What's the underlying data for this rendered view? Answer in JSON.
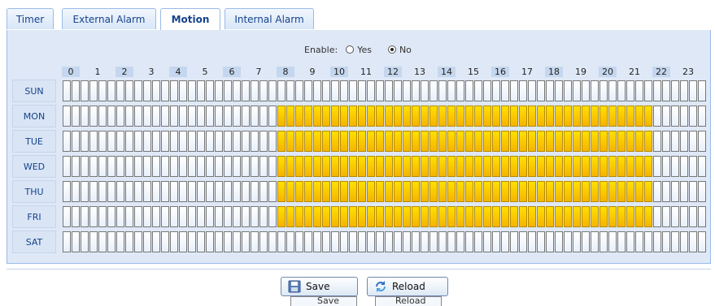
{
  "tabs": [
    {
      "label": "Timer",
      "active": false
    },
    {
      "label": "External Alarm",
      "active": false
    },
    {
      "label": "Motion",
      "active": true
    },
    {
      "label": "Internal Alarm",
      "active": false
    }
  ],
  "enable": {
    "label": "Enable:",
    "yes_label": "Yes",
    "no_label": "No",
    "selected": "No"
  },
  "hours": [
    "0",
    "1",
    "2",
    "3",
    "4",
    "5",
    "6",
    "7",
    "8",
    "9",
    "10",
    "11",
    "12",
    "13",
    "14",
    "15",
    "16",
    "17",
    "18",
    "19",
    "20",
    "21",
    "22",
    "23"
  ],
  "days": [
    "SUN",
    "MON",
    "TUE",
    "WED",
    "THU",
    "FRI",
    "SAT"
  ],
  "schedule": {
    "SUN": [],
    "MON": [
      8,
      9,
      10,
      11,
      12,
      13,
      14,
      15,
      16,
      17,
      18,
      19,
      20,
      21
    ],
    "TUE": [
      8,
      9,
      10,
      11,
      12,
      13,
      14,
      15,
      16,
      17,
      18,
      19,
      20,
      21
    ],
    "WED": [
      8,
      9,
      10,
      11,
      12,
      13,
      14,
      15,
      16,
      17,
      18,
      19,
      20,
      21
    ],
    "THU": [
      8,
      9,
      10,
      11,
      12,
      13,
      14,
      15,
      16,
      17,
      18,
      19,
      20,
      21
    ],
    "FRI": [
      8,
      9,
      10,
      11,
      12,
      13,
      14,
      15,
      16,
      17,
      18,
      19,
      20,
      21
    ],
    "SAT": []
  },
  "buttons": {
    "save_label": "Save",
    "reload_label": "Reload",
    "save_icon": "floppy-disk-icon",
    "reload_icon": "refresh-icon"
  },
  "colors": {
    "active_cell": "#f5c400",
    "inactive_cell": "#eef4fc",
    "panel": "#dfe8f6"
  }
}
